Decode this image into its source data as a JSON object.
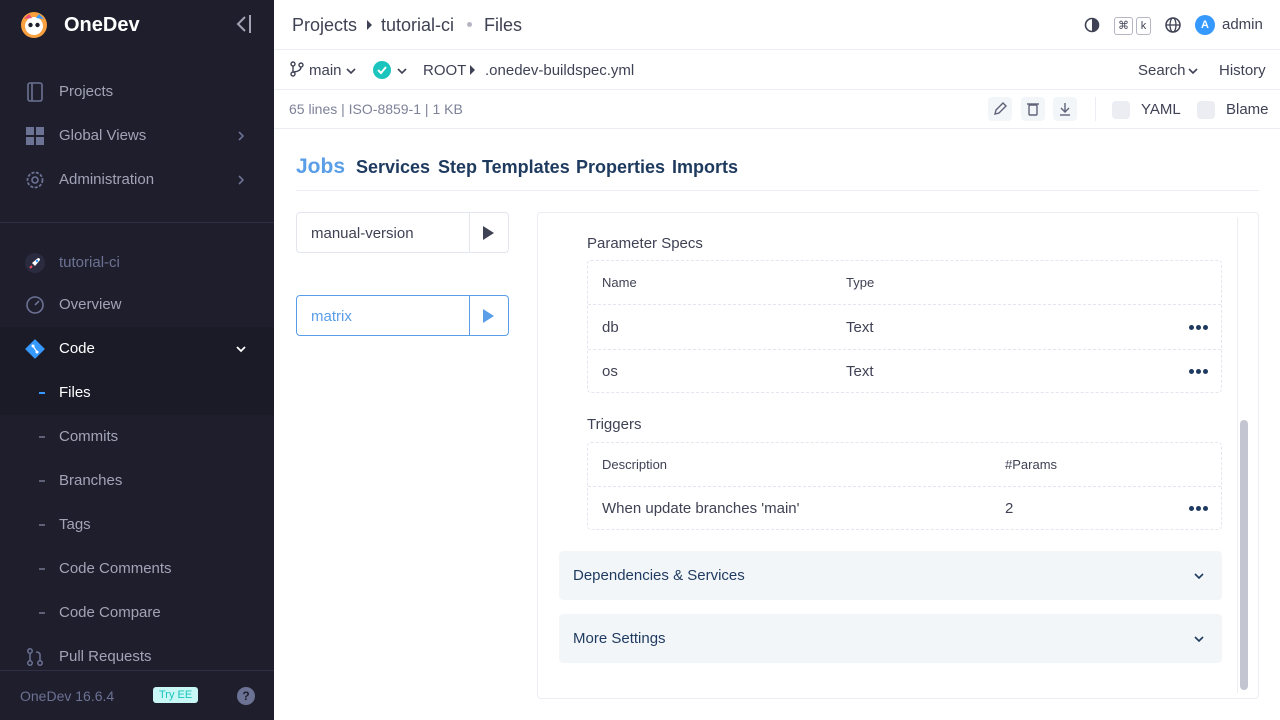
{
  "sidebar": {
    "app_name": "OneDev",
    "nav": [
      {
        "label": "Projects",
        "icon": "projects-icon"
      },
      {
        "label": "Global Views",
        "icon": "grid-icon"
      },
      {
        "label": "Administration",
        "icon": "gear-icon"
      }
    ],
    "project": {
      "label": "tutorial-ci",
      "icon": "rocket-icon"
    },
    "project_nav": {
      "overview": "Overview",
      "code": "Code",
      "code_sub": [
        "Files",
        "Commits",
        "Branches",
        "Tags",
        "Code Comments",
        "Code Compare"
      ],
      "pull_requests": "Pull Requests"
    },
    "footer": {
      "version": "OneDev 16.6.4",
      "try_ee": "Try EE",
      "help": "?"
    }
  },
  "topbar": {
    "breadcrumb": [
      "Projects",
      "tutorial-ci",
      "Files"
    ],
    "kbd": [
      "⌘",
      "k"
    ],
    "avatar_letter": "A",
    "username": "admin"
  },
  "filebar": {
    "branch": "main",
    "path_root": "ROOT",
    "path_file": ".onedev-buildspec.yml",
    "search": "Search",
    "history": "History",
    "fileinfo": "65 lines | ISO-8859-1 | 1 KB",
    "yaml": "YAML",
    "blame": "Blame"
  },
  "tabs": [
    "Jobs",
    "Services",
    "Step Templates",
    "Properties",
    "Imports"
  ],
  "jobs": [
    {
      "name": "manual-version",
      "active": false
    },
    {
      "name": "matrix",
      "active": true
    }
  ],
  "param_specs": {
    "title": "Parameter Specs",
    "headers": [
      "Name",
      "Type"
    ],
    "rows": [
      {
        "name": "db",
        "type": "Text"
      },
      {
        "name": "os",
        "type": "Text"
      }
    ]
  },
  "triggers": {
    "title": "Triggers",
    "headers": [
      "Description",
      "#Params"
    ],
    "rows": [
      {
        "description": "When update branches 'main'",
        "params": "2"
      }
    ]
  },
  "accordions": [
    "Dependencies & Services",
    "More Settings"
  ],
  "colors": {
    "sidebar_bg": "#1e1e2d",
    "accent": "#5a9ee8",
    "success": "#1bc5bd"
  }
}
